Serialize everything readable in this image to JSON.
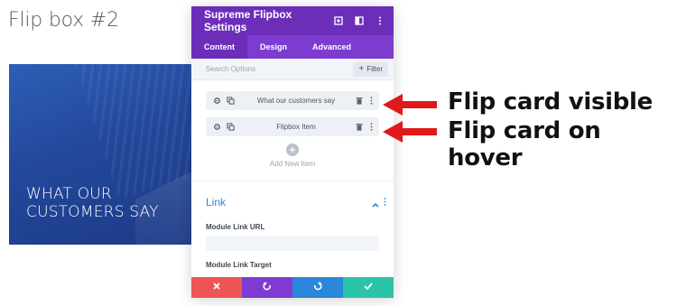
{
  "page": {
    "title": "Flip box #2"
  },
  "preview": {
    "text": "WHAT OUR\nCUSTOMERS SAY"
  },
  "modal": {
    "title": "Supreme Flipbox Settings",
    "tabs": [
      {
        "label": "Content",
        "active": true
      },
      {
        "label": "Design",
        "active": false
      },
      {
        "label": "Advanced",
        "active": false
      }
    ],
    "search": {
      "placeholder": "Search Options"
    },
    "filter_label": "Filter",
    "items": [
      {
        "label": "What our customers say"
      },
      {
        "label": "Flipbox Item"
      }
    ],
    "add_item_label": "Add New Item",
    "link_section": {
      "title": "Link",
      "fields": [
        {
          "label": "Module Link URL",
          "value": ""
        },
        {
          "label": "Module Link Target"
        }
      ]
    },
    "footer": {
      "buttons": [
        {
          "name": "cancel",
          "icon": "close-icon",
          "color": "#ef5555"
        },
        {
          "name": "undo",
          "icon": "undo-icon",
          "color": "#7e3bd0"
        },
        {
          "name": "redo",
          "icon": "redo-icon",
          "color": "#2b87da"
        },
        {
          "name": "save",
          "icon": "check-icon",
          "color": "#29c4a9"
        }
      ]
    }
  },
  "annotations": [
    {
      "text": "Flip card visible"
    },
    {
      "text": "Flip card on hover"
    }
  ],
  "colors": {
    "header": "#6c2eb9",
    "tabs": "#7d3bcf",
    "accent_blue": "#2b87da",
    "arrow_red": "#e0191b"
  }
}
